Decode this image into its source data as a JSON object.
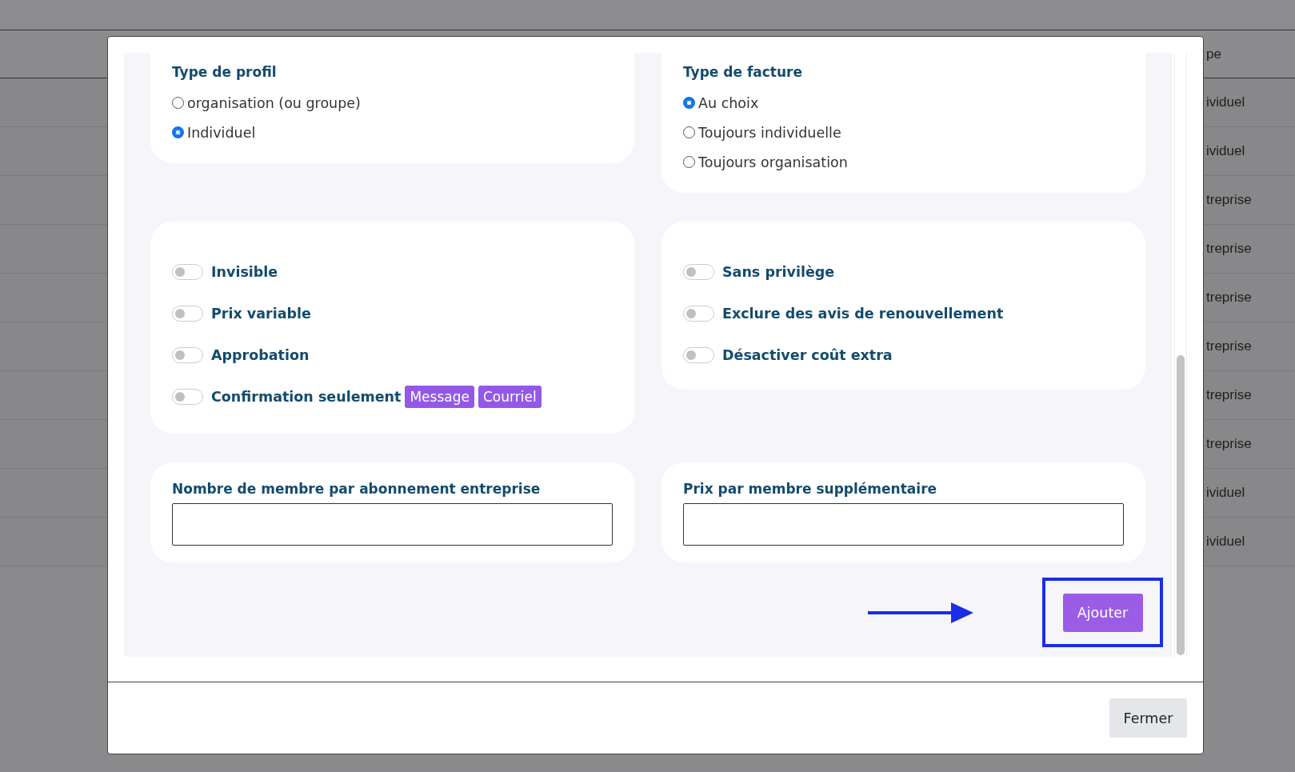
{
  "background_table": {
    "header": "pe",
    "rows": [
      "ividuel",
      "ividuel",
      "treprise",
      "treprise",
      "treprise",
      "treprise",
      "treprise",
      "treprise",
      "ividuel",
      "ividuel"
    ]
  },
  "modal": {
    "profile_type": {
      "title": "Type de profil",
      "options": [
        {
          "label": "organisation (ou groupe)",
          "selected": false
        },
        {
          "label": "Individuel",
          "selected": true
        }
      ]
    },
    "invoice_type": {
      "title": "Type de facture",
      "options": [
        {
          "label": "Au choix",
          "selected": true
        },
        {
          "label": "Toujours individuelle",
          "selected": false
        },
        {
          "label": "Toujours organisation",
          "selected": false
        }
      ]
    },
    "toggles_left": [
      {
        "label": "Invisible",
        "on": false
      },
      {
        "label": "Prix variable",
        "on": false
      },
      {
        "label": "Approbation",
        "on": false
      },
      {
        "label": "Confirmation seulement",
        "on": false,
        "tags": [
          "Message",
          "Courriel"
        ]
      }
    ],
    "toggles_right": [
      {
        "label": "Sans privilège",
        "on": false
      },
      {
        "label": "Exclure des avis de renouvellement",
        "on": false
      },
      {
        "label": "Désactiver coût extra",
        "on": false
      }
    ],
    "fields": [
      {
        "label": "Nombre de membre par abonnement entreprise"
      },
      {
        "label": "Prix par membre supplémentaire"
      }
    ],
    "add_button": "Ajouter",
    "close_button": "Fermer"
  }
}
